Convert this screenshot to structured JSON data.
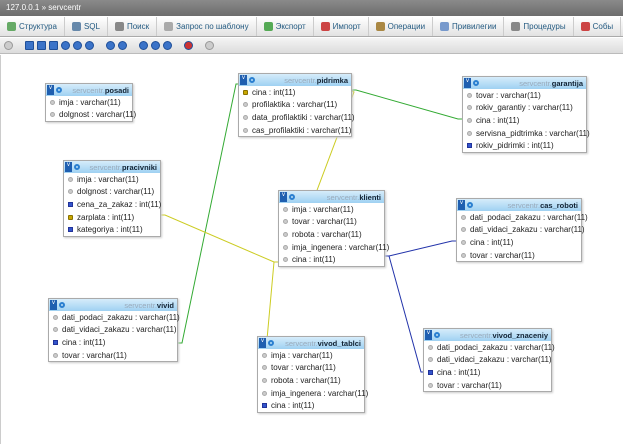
{
  "breadcrumb": {
    "server": "127.0.0.1",
    "separator": "»",
    "database": "servcentr"
  },
  "tabs": [
    "Структура",
    "SQL",
    "Поиск",
    "Запрос по шаблону",
    "Экспорт",
    "Импорт",
    "Операции",
    "Привилегии",
    "Процедуры",
    "Собы"
  ],
  "db_prefix": "servcentr.",
  "tables": [
    {
      "name": "posadi",
      "cols": [
        [
          "imja : varchar(11)",
          ""
        ],
        [
          "dolgnost : varchar(11)",
          ""
        ]
      ]
    },
    {
      "name": "pidrimka",
      "cols": [
        [
          "cina : int(11)",
          "key"
        ],
        [
          "profilaktika : varchar(11)",
          ""
        ],
        [
          "data_profilaktiki : varchar(11)",
          ""
        ],
        [
          "cas_profilaktiki : varchar(11)",
          ""
        ]
      ]
    },
    {
      "name": "garantija",
      "cols": [
        [
          "tovar : varchar(11)",
          ""
        ],
        [
          "rokiv_garantiy : varchar(11)",
          ""
        ],
        [
          "cina : int(11)",
          ""
        ],
        [
          "servisna_pidtrimka : varchar(11)",
          ""
        ],
        [
          "rokiv_pidrimki : int(11)",
          "idx"
        ]
      ]
    },
    {
      "name": "pracivniki",
      "cols": [
        [
          "imja : varchar(11)",
          ""
        ],
        [
          "dolgnost : varchar(11)",
          ""
        ],
        [
          "cena_za_zakaz : int(11)",
          "idx"
        ],
        [
          "zarplata : int(11)",
          "key"
        ],
        [
          "kategoriya : int(11)",
          "idx"
        ]
      ]
    },
    {
      "name": "klienti",
      "cols": [
        [
          "imja : varchar(11)",
          ""
        ],
        [
          "tovar : varchar(11)",
          ""
        ],
        [
          "robota : varchar(11)",
          ""
        ],
        [
          "imja_ingenera : varchar(11)",
          ""
        ],
        [
          "cina : int(11)",
          ""
        ]
      ]
    },
    {
      "name": "cas_roboti",
      "cols": [
        [
          "dati_podaci_zakazu : varchar(11)",
          ""
        ],
        [
          "dati_vidaci_zakazu : varchar(11)",
          ""
        ],
        [
          "cina : int(11)",
          ""
        ],
        [
          "tovar : varchar(11)",
          ""
        ]
      ]
    },
    {
      "name": "vivid",
      "cols": [
        [
          "dati_podaci_zakazu : varchar(11)",
          ""
        ],
        [
          "dati_vidaci_zakazu : varchar(11)",
          ""
        ],
        [
          "cina : int(11)",
          "idx"
        ],
        [
          "tovar : varchar(11)",
          ""
        ]
      ]
    },
    {
      "name": "vivod_tablci",
      "cols": [
        [
          "imja : varchar(11)",
          ""
        ],
        [
          "tovar : varchar(11)",
          ""
        ],
        [
          "robota : varchar(11)",
          ""
        ],
        [
          "imja_ingenera : varchar(11)",
          ""
        ],
        [
          "cina : int(11)",
          "idx"
        ]
      ]
    },
    {
      "name": "vivod_znaceniy",
      "cols": [
        [
          "dati_podaci_zakazu : varchar(11)",
          ""
        ],
        [
          "dati_vidaci_zakazu : varchar(11)",
          ""
        ],
        [
          "cina : int(11)",
          "idx"
        ],
        [
          "tovar : varchar(11)",
          ""
        ]
      ]
    }
  ],
  "colors": {
    "relation_green": "#33aa33",
    "relation_yellow": "#cccc22",
    "relation_blue": "#2233aa"
  }
}
